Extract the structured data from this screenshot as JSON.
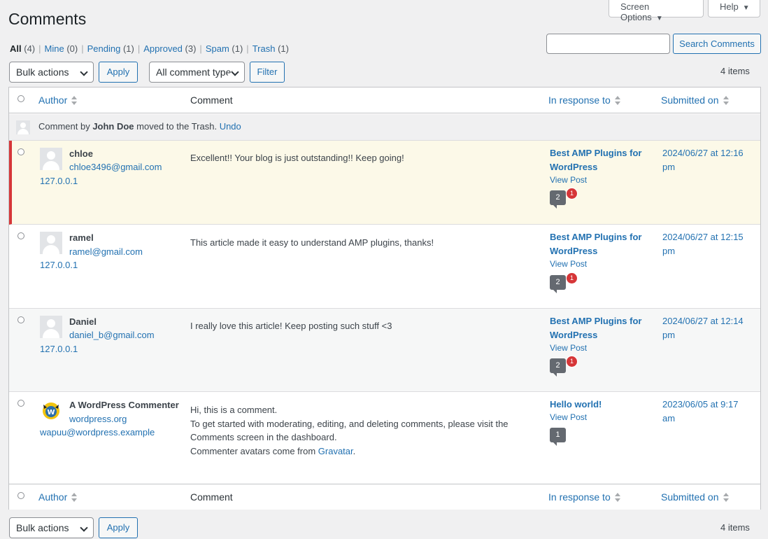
{
  "page": {
    "title": "Comments"
  },
  "header": {
    "screen_options": "Screen Options",
    "help": "Help"
  },
  "filters": [
    {
      "label": "All",
      "count": "(4)"
    },
    {
      "label": "Mine",
      "count": "(0)"
    },
    {
      "label": "Pending",
      "count": "(1)"
    },
    {
      "label": "Approved",
      "count": "(3)"
    },
    {
      "label": "Spam",
      "count": "(1)"
    },
    {
      "label": "Trash",
      "count": "(1)"
    }
  ],
  "search": {
    "value": "",
    "button": "Search Comments"
  },
  "toolbar_top": {
    "bulk_actions": "Bulk actions",
    "apply": "Apply",
    "comment_type": "All comment types",
    "filter": "Filter",
    "items": "4 items"
  },
  "toolbar_bottom": {
    "bulk_actions": "Bulk actions",
    "apply": "Apply",
    "items": "4 items"
  },
  "columns": {
    "author": "Author",
    "comment": "Comment",
    "in_response_to": "In response to",
    "submitted_on": "Submitted on"
  },
  "trash_notice": {
    "prefix": "Comment by ",
    "author": "John Doe",
    "suffix": " moved to the Trash.",
    "undo": "Undo"
  },
  "comments": [
    {
      "author": "chloe",
      "email": "chloe3496@gmail.com",
      "ip": "127.0.0.1",
      "text": "Excellent!! Your blog is just outstanding!! Keep going!",
      "post": "Best AMP Plugins for WordPress",
      "view_post": "View Post",
      "approved_count": "2",
      "pending_count": "1",
      "date": "2024/06/27 at 12:16 pm",
      "status": "pending"
    },
    {
      "author": "ramel",
      "email": "ramel@gmail.com",
      "ip": "127.0.0.1",
      "text": "This article made it easy to understand AMP plugins, thanks!",
      "post": "Best AMP Plugins for WordPress",
      "view_post": "View Post",
      "approved_count": "2",
      "pending_count": "1",
      "date": "2024/06/27 at 12:15 pm",
      "status": "approved"
    },
    {
      "author": "Daniel",
      "email": "daniel_b@gmail.com",
      "ip": "127.0.0.1",
      "text": "I really love this article! Keep posting such stuff <3",
      "post": "Best AMP Plugins for WordPress",
      "view_post": "View Post",
      "approved_count": "2",
      "pending_count": "1",
      "date": "2024/06/27 at 12:14 pm",
      "status": "approved"
    },
    {
      "author": "A WordPress Commenter",
      "url": "wordpress.org",
      "email": "wapuu@wordpress.example",
      "text_lines": [
        "Hi, this is a comment.",
        "To get started with moderating, editing, and deleting comments, please visit the",
        "Comments screen in the dashboard.",
        "Commenter avatars come from "
      ],
      "text_link": "Gravatar",
      "text_end": ".",
      "post": "Hello world!",
      "view_post": "View Post",
      "approved_count": "1",
      "date": "2023/06/05 at 9:17 am",
      "status": "approved"
    }
  ]
}
